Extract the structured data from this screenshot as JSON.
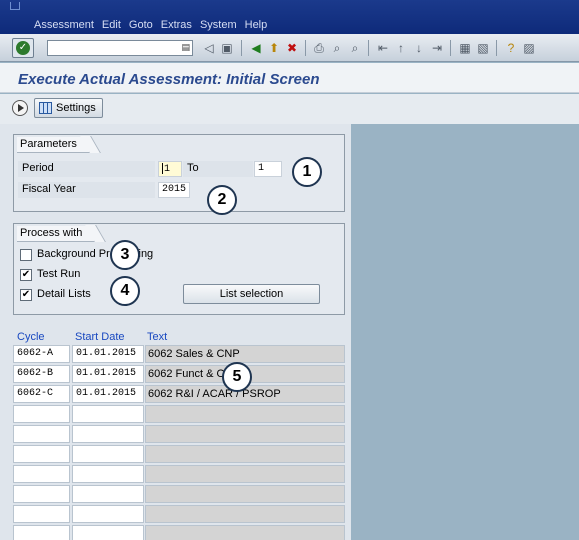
{
  "menu": [
    "Assessment",
    "Edit",
    "Goto",
    "Extras",
    "System",
    "Help"
  ],
  "title": "Execute Actual Assessment: Initial Screen",
  "settings_label": "Settings",
  "parameters": {
    "title": "Parameters",
    "period_label": "Period",
    "period_from": "1",
    "to_label": "To",
    "period_to": "1",
    "fiscal_year_label": "Fiscal Year",
    "fiscal_year": "2015"
  },
  "process": {
    "title": "Process with",
    "background_label": "Background Processing",
    "test_run_label": "Test Run",
    "detail_lists_label": "Detail Lists",
    "list_selection_label": "List selection"
  },
  "checks": {
    "background": false,
    "test_run": true,
    "detail_lists": true
  },
  "table": {
    "headers": [
      "Cycle",
      "Start Date",
      "Text"
    ],
    "rows": [
      {
        "cycle": "6062-A",
        "date": "01.01.2015",
        "text": "6062 Sales & CNP"
      },
      {
        "cycle": "6062-B",
        "date": "01.01.2015",
        "text": "6062 Funct & OH"
      },
      {
        "cycle": "6062-C",
        "date": "01.01.2015",
        "text": "6062 R&I / ACAR / PSROP"
      }
    ]
  },
  "callouts": [
    "1",
    "2",
    "3",
    "4",
    "5"
  ]
}
